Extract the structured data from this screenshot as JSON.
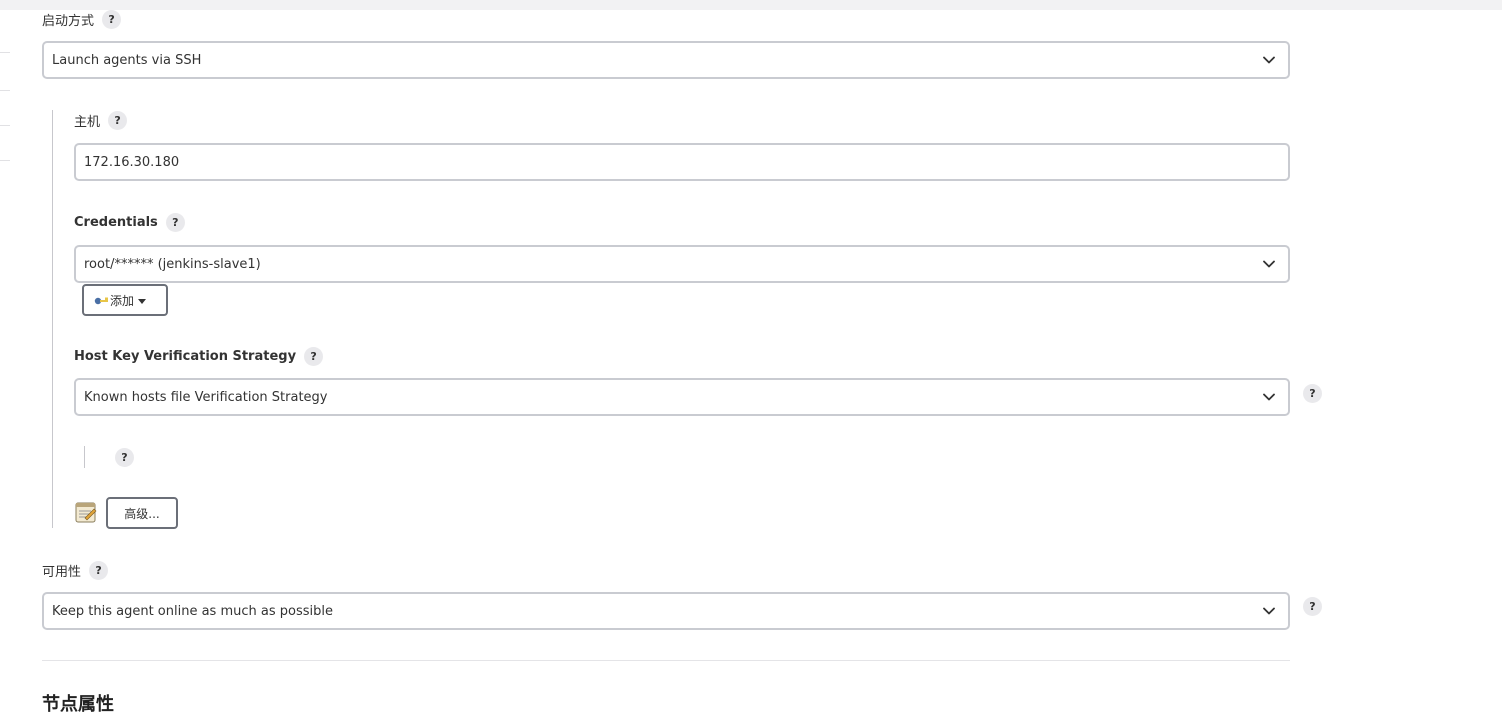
{
  "launch": {
    "label": "启动方式",
    "value": "Launch agents via SSH"
  },
  "host": {
    "label": "主机",
    "value": "172.16.30.180"
  },
  "credentials": {
    "label": "Credentials",
    "value": "root/****** (jenkins-slave1)",
    "add_label": "添加"
  },
  "host_key": {
    "label": "Host Key Verification Strategy",
    "value": "Known hosts file Verification Strategy"
  },
  "advanced": {
    "label": "高级..."
  },
  "availability": {
    "label": "可用性",
    "value": "Keep this agent online as much as possible"
  },
  "section": {
    "title": "节点属性"
  },
  "help_glyph": "?",
  "icons": [
    "help-icon",
    "chevron-down-icon",
    "key-icon",
    "caret-down-icon",
    "notepad-icon"
  ]
}
